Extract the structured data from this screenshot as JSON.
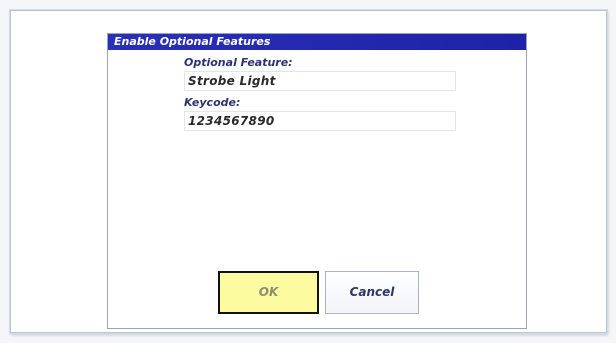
{
  "dialog": {
    "title": "Enable Optional Features",
    "feature_label": "Optional Feature:",
    "feature_value": "Strobe Light",
    "keycode_label": "Keycode:",
    "keycode_value": "1234567890",
    "ok_label": "OK",
    "cancel_label": "Cancel"
  },
  "colors": {
    "title_bar": "#2a2fb8",
    "label_text": "#2c3370",
    "ok_button_bg": "#fdfba0",
    "ok_button_border": "#111111"
  }
}
